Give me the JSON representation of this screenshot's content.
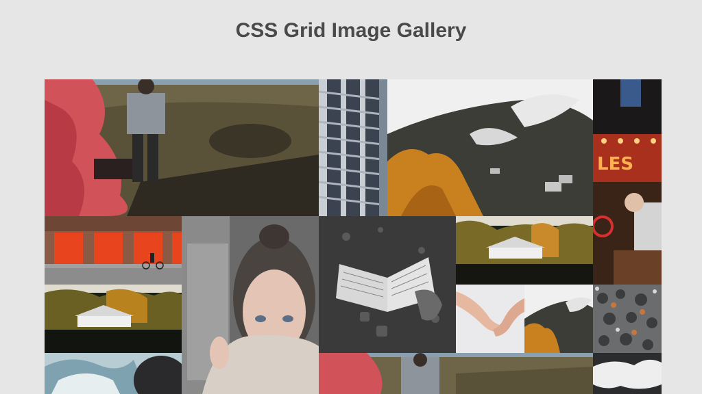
{
  "page": {
    "title": "CSS Grid Image Gallery"
  },
  "gallery": {
    "images": [
      {
        "subject": "person walking on hillside with red smoke"
      },
      {
        "subject": "glass skyscraper facade"
      },
      {
        "subject": "misty forest mountain with autumn trees"
      },
      {
        "subject": "neon sign bar and bartender"
      },
      {
        "subject": "fire station with red doors and cyclist"
      },
      {
        "subject": "woman with sweater pulled over face"
      },
      {
        "subject": "open book held in hand"
      },
      {
        "subject": "white house in autumn forest"
      },
      {
        "subject": "white house in autumn forest"
      },
      {
        "subject": "holding hands"
      },
      {
        "subject": "misty forest mountain with autumn trees"
      },
      {
        "subject": "snowy forest from above"
      },
      {
        "subject": "blue smoke"
      },
      {
        "subject": "person walking on hillside with red smoke"
      },
      {
        "subject": "clouds over dark forest"
      }
    ]
  }
}
